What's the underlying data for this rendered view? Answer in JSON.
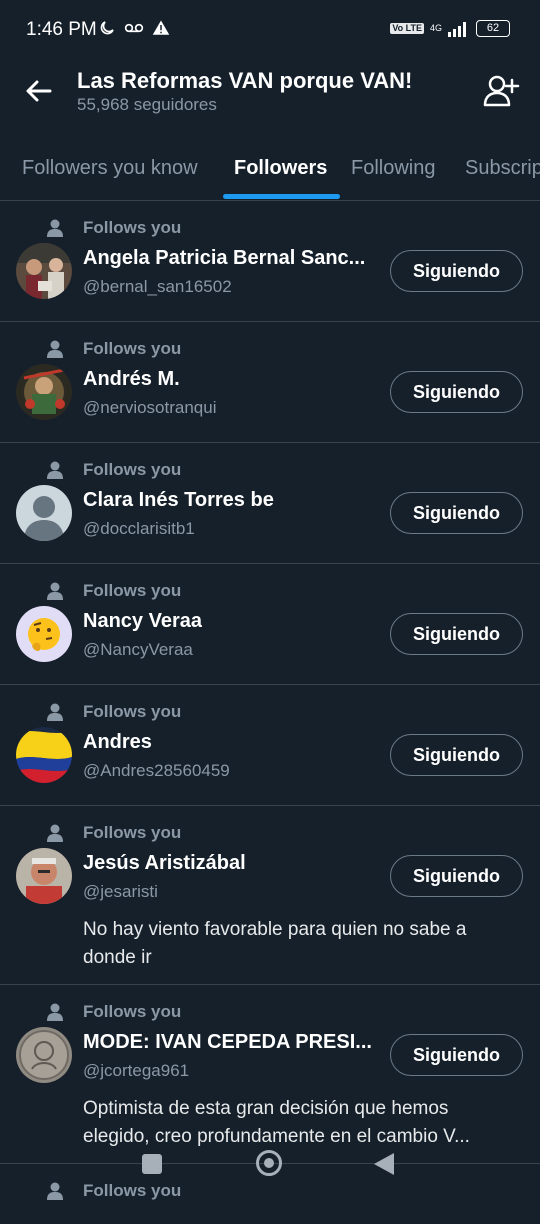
{
  "status_bar": {
    "time": "1:46 PM",
    "left_icons": [
      "moon-icon",
      "voicemail-icon",
      "warning-icon"
    ],
    "volte": "Vo LTE",
    "network": "4G",
    "battery": "62"
  },
  "header": {
    "title": "Las Reformas VAN porque VAN!",
    "subtitle": "55,968 seguidores"
  },
  "tabs": [
    {
      "label": "Followers you know",
      "active": false
    },
    {
      "label": "Followers",
      "active": true
    },
    {
      "label": "Following",
      "active": false
    },
    {
      "label": "Subscriptions",
      "active": false
    }
  ],
  "colors": {
    "background": "#15202b",
    "accent": "#1d9bf0",
    "secondary_text": "#8b98a5",
    "divider": "#38444d"
  },
  "followers": [
    {
      "follows_label": "Follows you",
      "name": "Angela Patricia Bernal Sanc...",
      "handle": "@bernal_san16502",
      "button": "Siguiendo",
      "bio": ""
    },
    {
      "follows_label": "Follows you",
      "name": "Andrés M.",
      "handle": "@nerviosotranqui",
      "button": "Siguiendo",
      "bio": ""
    },
    {
      "follows_label": "Follows you",
      "name": "Clara Inés Torres be",
      "handle": "@docclarisitb1",
      "button": "Siguiendo",
      "bio": ""
    },
    {
      "follows_label": "Follows you",
      "name": "Nancy Veraa",
      "handle": "@NancyVeraa",
      "button": "Siguiendo",
      "bio": ""
    },
    {
      "follows_label": "Follows you",
      "name": "Andres",
      "handle": "@Andres28560459",
      "button": "Siguiendo",
      "bio": ""
    },
    {
      "follows_label": "Follows you",
      "name": "Jesús Aristizábal",
      "handle": "@jesaristi",
      "button": "Siguiendo",
      "bio": "No hay viento favorable para quien no sabe a donde ir"
    },
    {
      "follows_label": "Follows you",
      "name": "MODE: IVAN CEPEDA PRESI...",
      "handle": "@jcortega961",
      "button": "Siguiendo",
      "bio": "Optimista de esta gran decisión que hemos elegido, creo profundamente en el cambio V..."
    },
    {
      "follows_label": "Follows you",
      "name": "",
      "handle": "",
      "button": "",
      "bio": ""
    }
  ]
}
